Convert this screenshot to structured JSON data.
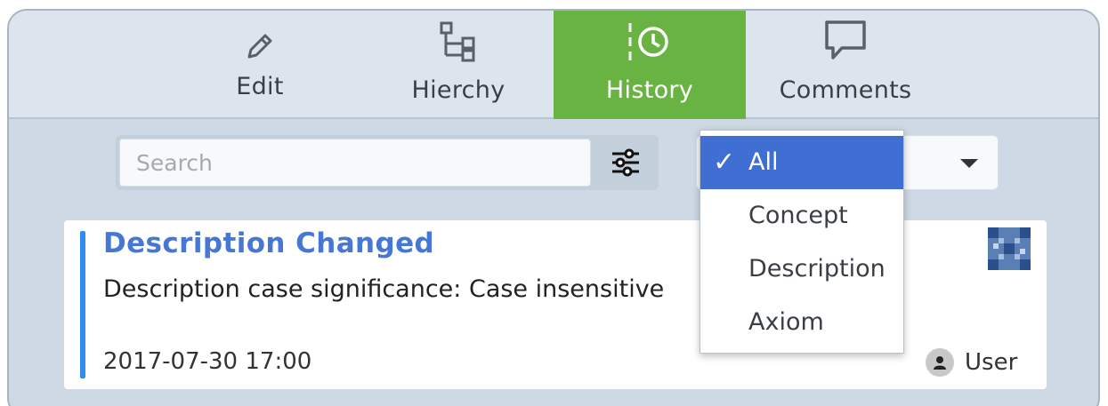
{
  "tabs": {
    "edit": "Edit",
    "hierarchy": "Hierchy",
    "history": "History",
    "comments": "Comments",
    "active": "History"
  },
  "search": {
    "placeholder": "Search",
    "value": ""
  },
  "type_filter": {
    "selected": "All",
    "options": [
      "All",
      "Concept",
      "Description",
      "Axiom"
    ]
  },
  "history_entry": {
    "title": "Description Changed",
    "description": "Description case significance: Case insensitive",
    "timestamp": "2017-07-30 17:00",
    "user": "User"
  },
  "colors": {
    "active_tab": "#69b342",
    "title": "#4677d6",
    "accent_bar": "#2d8ef0",
    "selected_option": "#3f6fd3"
  },
  "icons": [
    "pencil-icon",
    "hierarchy-icon",
    "history-icon",
    "comment-icon",
    "filter-sliders-icon",
    "user-icon",
    "thumbnail-icon",
    "checkmark-icon",
    "chevron-down-icon"
  ]
}
